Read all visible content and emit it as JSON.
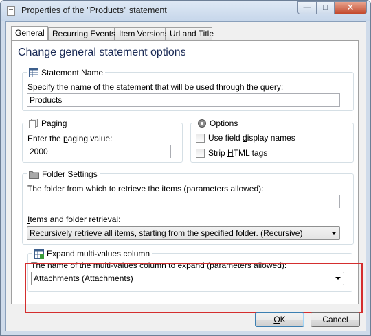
{
  "window": {
    "title": "Properties of the \"Products\" statement"
  },
  "tabs": [
    {
      "label": "General"
    },
    {
      "label": "Recurring Events"
    },
    {
      "label": "Item Versions"
    },
    {
      "label": "Url and Title"
    }
  ],
  "heading": "Change general statement options",
  "statement_name": {
    "title": "Statement Name",
    "desc_pre": "Specify the ",
    "desc_key": "n",
    "desc_post": "ame of the statement that will be used through the query:",
    "value": "Products"
  },
  "paging": {
    "title": "Paging",
    "label_pre": "Enter the ",
    "label_key": "p",
    "label_post": "aging value:",
    "value": "2000"
  },
  "options": {
    "title": "Options",
    "field_display_pre": "Use field ",
    "field_display_key": "d",
    "field_display_post": "isplay names",
    "strip_pre": "Strip ",
    "strip_key": "H",
    "strip_post": "TML tags"
  },
  "folder": {
    "title": "Folder Settings",
    "desc": "The folder from which to retrieve the items (parameters allowed):",
    "value": "",
    "retrieval_key": "I",
    "retrieval_post": "tems and folder retrieval:",
    "retrieval_value": "Recursively retrieve all items, starting from the specified folder. (Recursive)"
  },
  "expand": {
    "title": "Expand multi-values column",
    "desc_pre": "The name of the ",
    "desc_key": "m",
    "desc_post": "ulti-values column to expand (parameters allowed):",
    "value": "Attachments (Attachments)"
  },
  "buttons": {
    "ok_key": "O",
    "ok_post": "K",
    "cancel": "Cancel"
  },
  "colors": {
    "highlight": "#d42e2e",
    "heading": "#1a2a55"
  }
}
